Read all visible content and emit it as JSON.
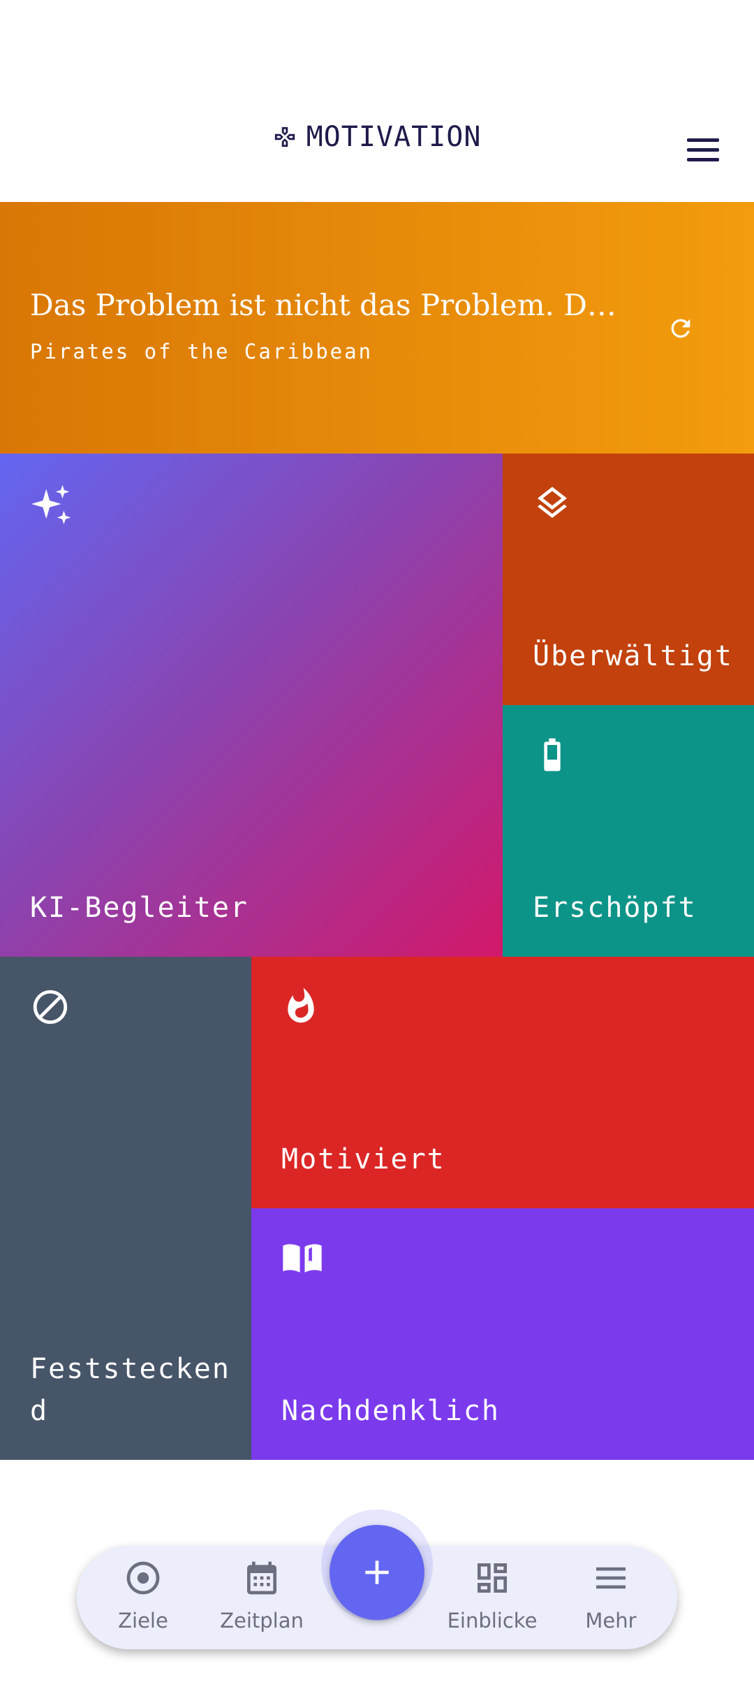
{
  "header": {
    "title": "MOTIVATION",
    "logo_icon": "gamepad-icon",
    "menu_icon": "hamburger-menu-icon"
  },
  "quote": {
    "text": "Das Problem ist nicht das Problem. Das P...",
    "source": "Pirates of the Caribbean",
    "refresh_icon": "refresh-icon"
  },
  "tiles": [
    {
      "label": "KI-Begleiter",
      "icon": "sparkles-icon"
    },
    {
      "label": "Überwältigt",
      "icon": "layers-icon",
      "color": "#c2410c"
    },
    {
      "label": "Erschöpft",
      "icon": "battery-icon",
      "color": "#0d9488"
    },
    {
      "label": "Feststeckend",
      "icon": "block-icon",
      "color": "#475569"
    },
    {
      "label": "Motiviert",
      "icon": "flame-icon",
      "color": "#dc2626"
    },
    {
      "label": "Nachdenklich",
      "icon": "open-book-icon",
      "color": "#7c3aed"
    }
  ],
  "nav": {
    "items": [
      {
        "label": "Ziele",
        "icon": "target-icon"
      },
      {
        "label": "Zeitplan",
        "icon": "calendar-icon"
      },
      {
        "label": "Einblicke",
        "icon": "dashboard-icon"
      },
      {
        "label": "Mehr",
        "icon": "menu-icon"
      }
    ],
    "fab_icon": "plus-icon",
    "accent": "#6366f1"
  }
}
